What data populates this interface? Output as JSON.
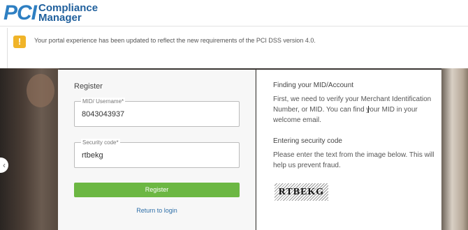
{
  "header": {
    "logo_pci": "PCI",
    "logo_line1": "Compliance",
    "logo_line2": "Manager"
  },
  "notice": {
    "icon": "warning-icon",
    "text": "Your portal experience has been updated to reflect the new requirements of the PCI DSS version 4.0."
  },
  "register": {
    "title": "Register",
    "mid_label": "MID/ Username*",
    "mid_value": "8043043937",
    "security_label": "Security code*",
    "security_value": "rtbekg",
    "button_label": "Register",
    "login_link": "Return to login"
  },
  "info": {
    "finding_title": "Finding your MID/Account",
    "finding_body": "First, we need to verify your Merchant Identification Number, or MID. You can find your MID in your welcome email.",
    "security_title": "Entering security code",
    "security_body": "Please enter the text from the image below. This will help us prevent fraud.",
    "captcha_text": "RTBEKG"
  },
  "colors": {
    "brand_blue": "#2e7fc2",
    "register_green": "#6cb743",
    "warning_yellow": "#f0b429",
    "link_blue": "#2e6fa8"
  }
}
